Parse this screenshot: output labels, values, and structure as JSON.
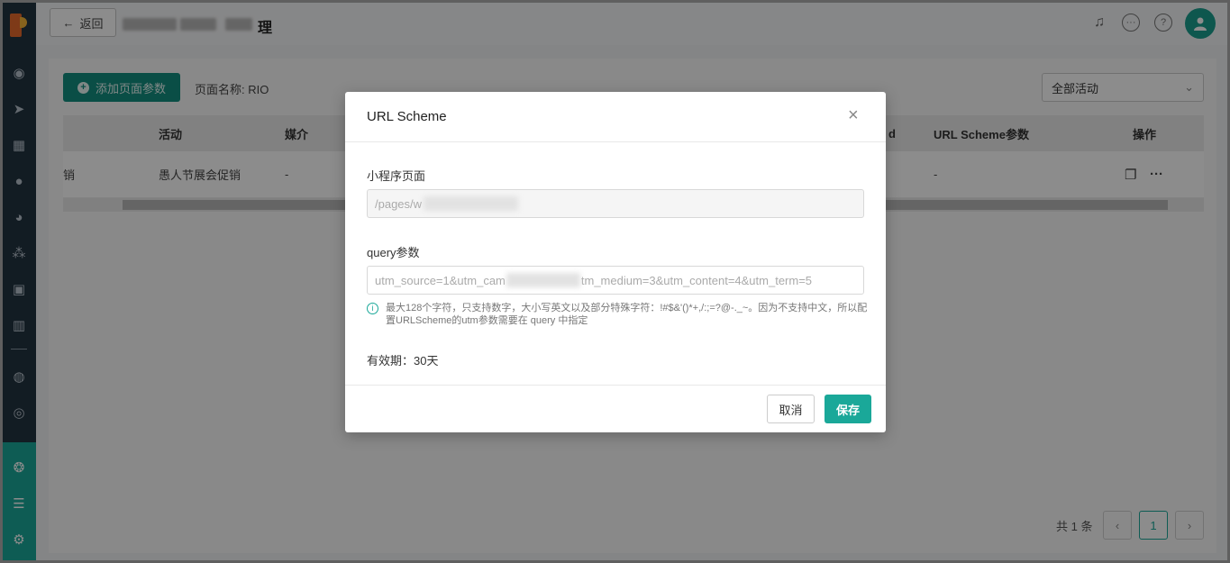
{
  "header": {
    "back_label": "返回",
    "title_suffix": "理"
  },
  "toolbar": {
    "add_label": "添加页面参数",
    "page_name": "页面名称: RIO",
    "activity_select": "全部活动"
  },
  "table": {
    "columns": {
      "activity": "活动",
      "medium": "媒介",
      "partial_id": "d",
      "url_scheme_params": "URL Scheme参数",
      "actions": "操作"
    },
    "rows": [
      {
        "first": "销",
        "activity": "愚人节展会促销",
        "medium": "-",
        "url_scheme_params": "-",
        "more": "···"
      }
    ]
  },
  "pagination": {
    "total": "共 1 条",
    "current_page": "1",
    "prev": "‹",
    "next": "›"
  },
  "modal": {
    "title": "URL Scheme",
    "close": "×",
    "page_label": "小程序页面",
    "page_value": "/pages/w",
    "query_label": "query参数",
    "query_value_start": "utm_source=1&utm_cam",
    "query_value_end": "tm_medium=3&utm_content=4&utm_term=5",
    "hint_icon": "i",
    "hint_text": "最大128个字符，只支持数字，大小写英文以及部分特殊字符：!#$&'()*+,/:;=?@-._~。因为不支持中文，所以配置URLScheme的utm参数需要在 query 中指定",
    "validity": "有效期：30天",
    "cancel": "取消",
    "save": "保存"
  },
  "colors": {
    "primary": "#1aa899",
    "sidebar": "#223340"
  }
}
